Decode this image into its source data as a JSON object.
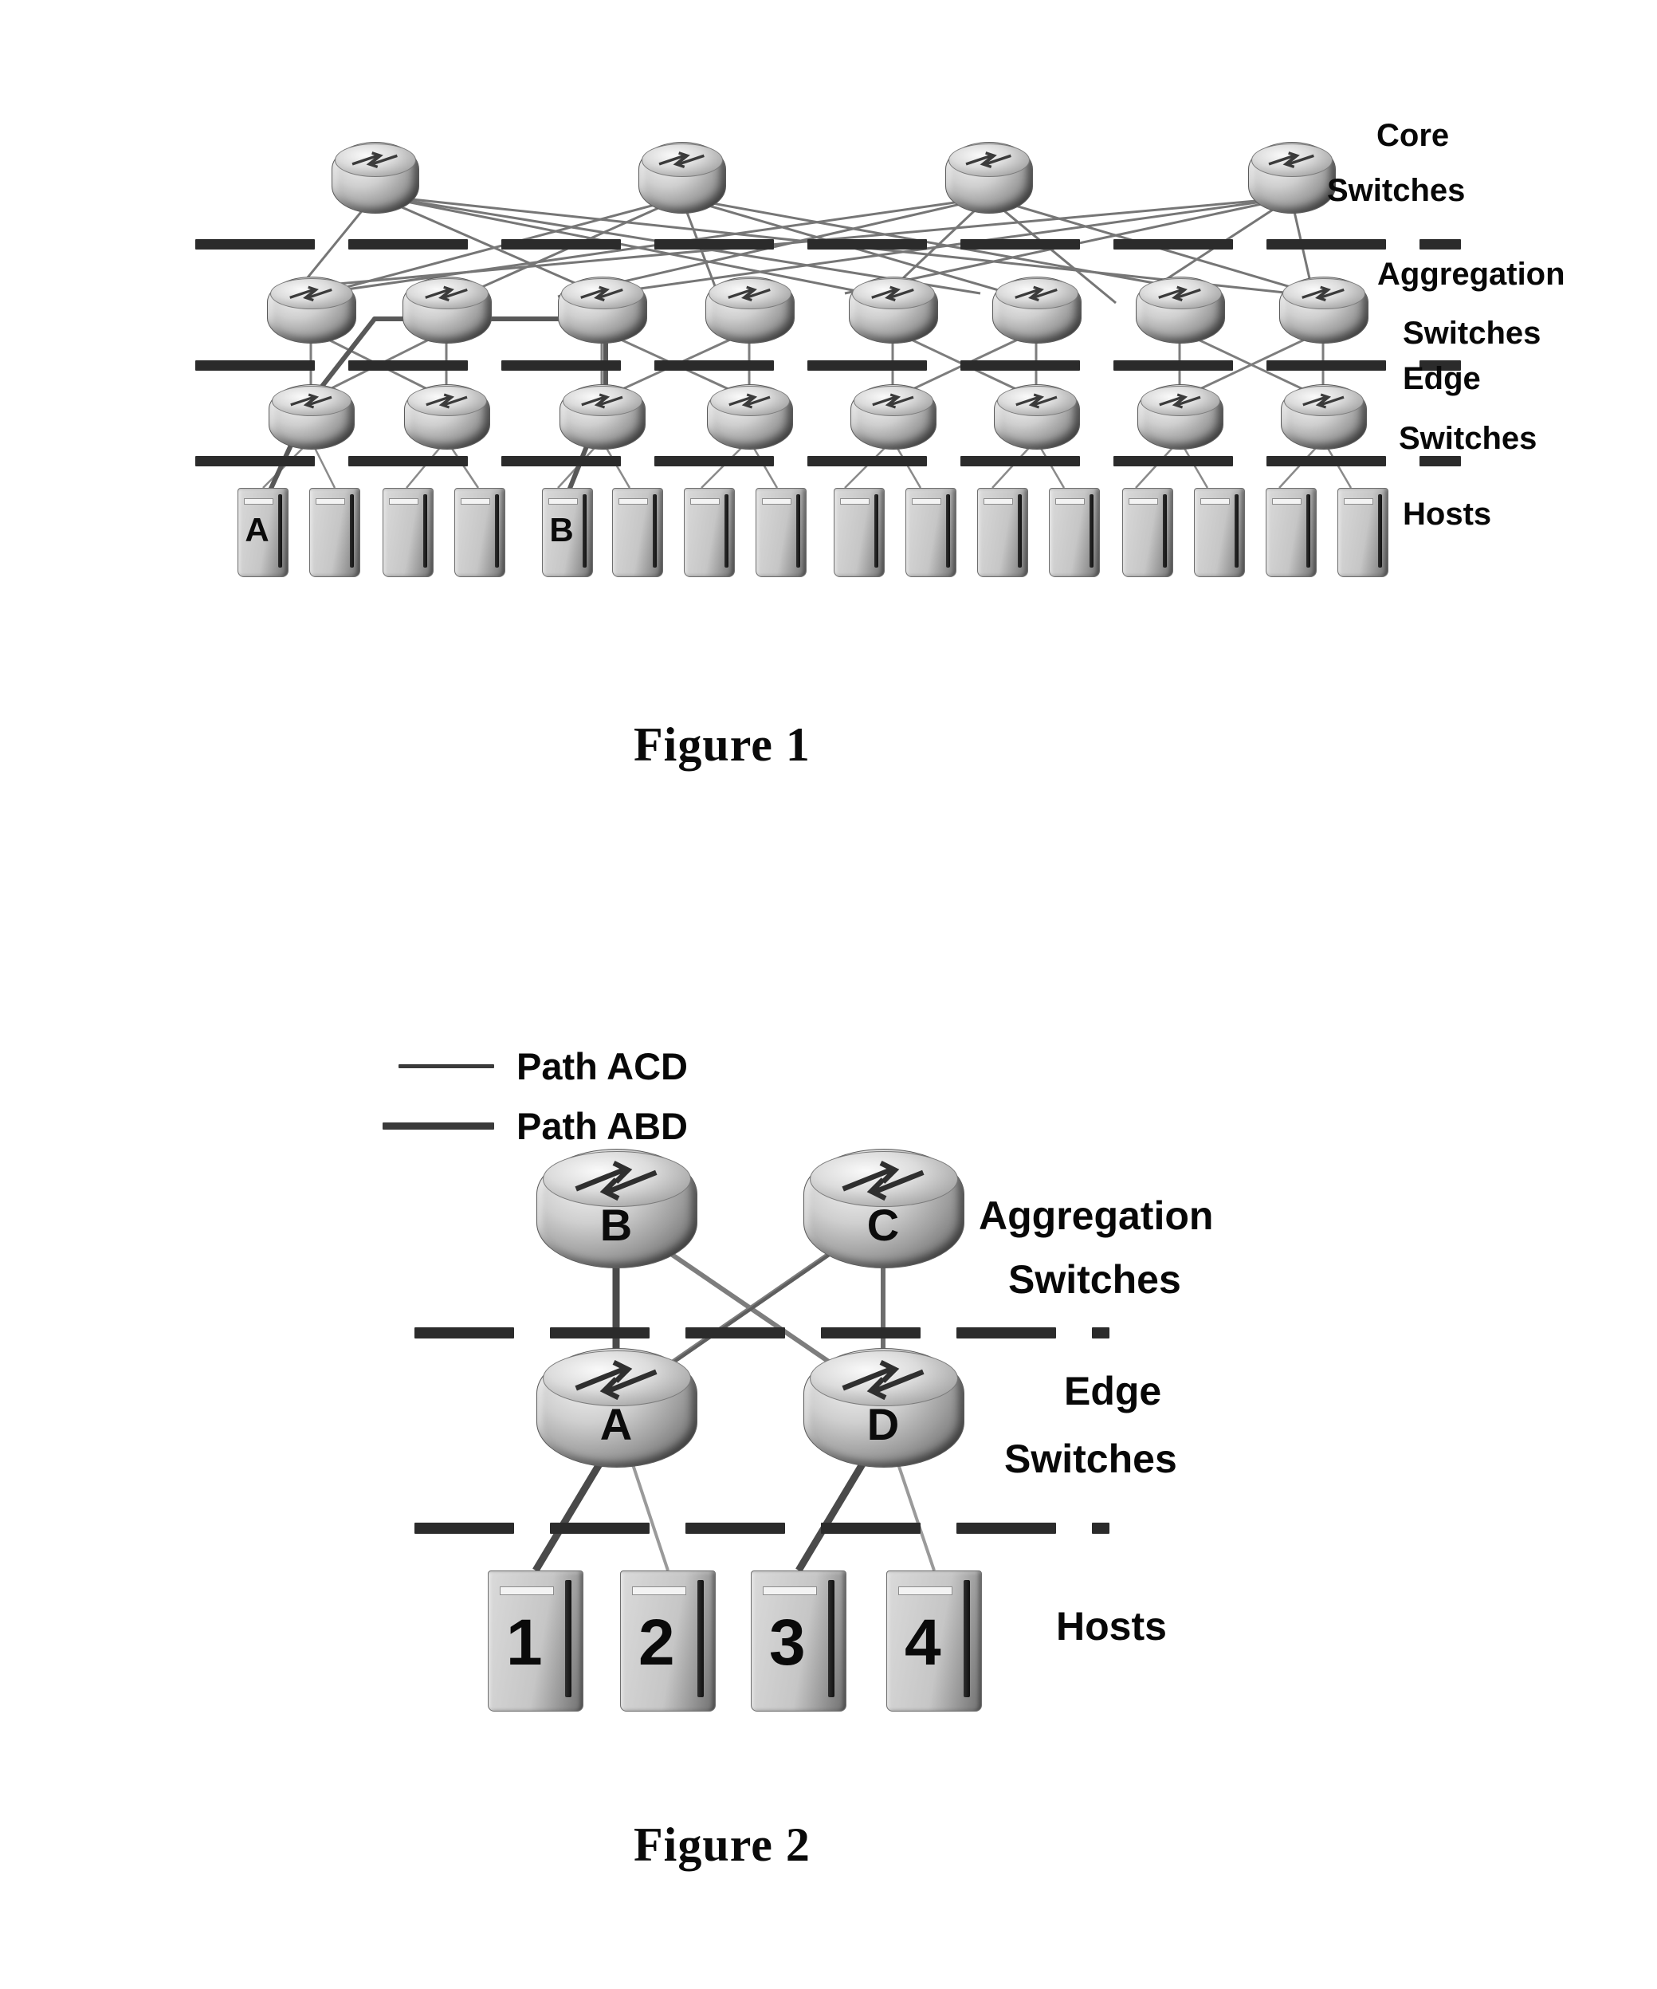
{
  "document": {
    "figures": [
      {
        "id": "figure-1",
        "caption": "Figure 1",
        "layer_labels": {
          "core_line1": "Core",
          "core_line2": "Switches",
          "aggregation_line1": "Aggregation",
          "aggregation_line2": "Switches",
          "edge_line1": "Edge",
          "edge_line2": "Switches",
          "hosts": "Hosts"
        },
        "counts": {
          "core_switches": 4,
          "aggregation_switches": 8,
          "edge_switches": 8,
          "hosts": 16
        },
        "host_labels": [
          "A",
          "",
          "",
          "",
          "B",
          "",
          "",
          "",
          "",
          "",
          "",
          "",
          "",
          "",
          "",
          ""
        ]
      },
      {
        "id": "figure-2",
        "caption": "Figure 2",
        "legend": [
          {
            "label": "Path ACD",
            "style": "thin-solid",
            "color": "#3a3a3a"
          },
          {
            "label": "Path ABD",
            "style": "thick-solid",
            "color": "#3a3a3a"
          }
        ],
        "layer_labels": {
          "aggregation_line1": "Aggregation",
          "aggregation_line2": "Switches",
          "edge_line1": "Edge",
          "edge_line2": "Switches",
          "hosts": "Hosts"
        },
        "aggregation_switches": [
          "B",
          "C"
        ],
        "edge_switches": [
          "A",
          "D"
        ],
        "hosts": [
          "1",
          "2",
          "3",
          "4"
        ]
      }
    ]
  },
  "colors": {
    "ink": "#080808",
    "dash": "#2b2b2b",
    "link": "#6b6b6b",
    "path": "#3a3a3a"
  }
}
